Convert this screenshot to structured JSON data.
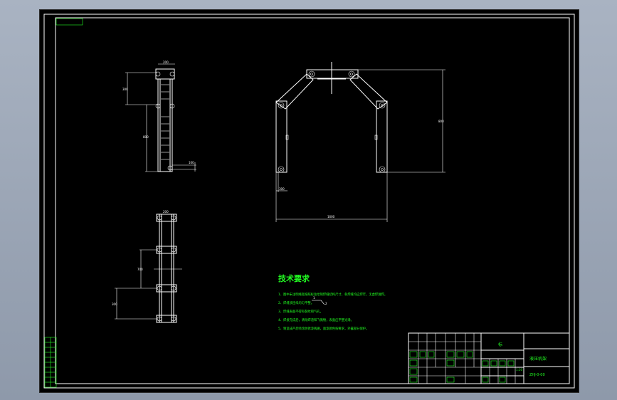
{
  "drawing": {
    "tech_requirements": {
      "title": "技术要求",
      "items": [
        "1、图中未注明线宽按照标准绘制焊缝结构尺寸，各焊缝均应焊牢，无虚焊漏焊。",
        "2、焊缝须连续均匀平整。",
        "3、焊缝表面不得有裂纹和气孔。",
        "4、焊接完成后，清除焊渣和飞溅物，表面应平整光滑。",
        "5、制造成产后喷涂防锈漆两遍，面漆颜色按要求，外露部分保护。"
      ],
      "marker": "1",
      "marker_note": "2"
    },
    "title_block": {
      "center_mark": "标",
      "name": "液压机架",
      "code": "ZHJ-0-00",
      "scale": "1:10"
    },
    "dims": {
      "left_top_height": "300",
      "left_mid_height": "800",
      "left_top_width": "200",
      "left_foot": "100",
      "right_height": "800",
      "right_width": "1600",
      "right_side": "300",
      "bottom_height": "700",
      "bottom_span": "300",
      "bottom_width": "200"
    }
  }
}
